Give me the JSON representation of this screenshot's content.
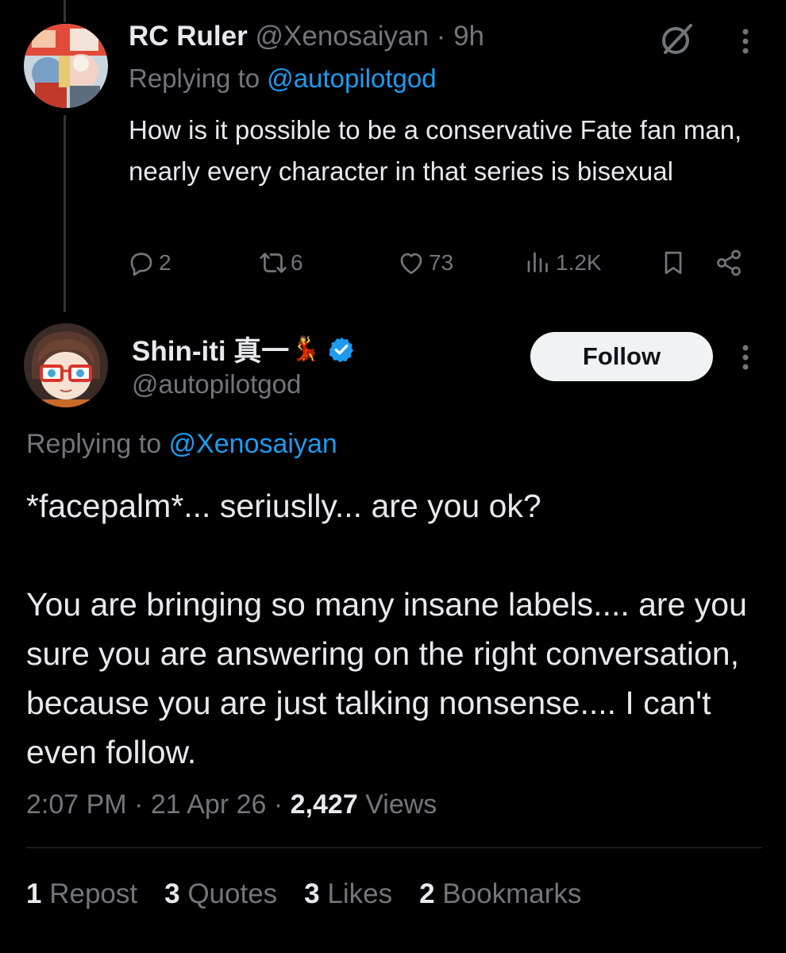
{
  "reply_tweet": {
    "display_name": "RC Ruler",
    "handle": "@Xenosaiyan",
    "separator": "·",
    "time": "9h",
    "replying_prefix": "Replying to",
    "replying_to": "@autopilotgod",
    "text": "How is it possible to be a conservative Fate fan man, nearly every character in that series is bisexual",
    "actions": {
      "reply_count": "2",
      "repost_count": "6",
      "like_count": "73",
      "views_count": "1.2K"
    }
  },
  "main_tweet": {
    "display_name": "Shin-iti 真一",
    "name_emoji": "💃",
    "handle": "@autopilotgod",
    "follow_label": "Follow",
    "replying_prefix": "Replying to",
    "replying_to": "@Xenosaiyan",
    "text": "*facepalm*... seriuslly... are you ok?\n\nYou are bringing so many insane labels.... are you sure you are answering on the right conversation, because you are just talking nonsense.... I can't even follow.",
    "time": "2:07 PM",
    "date": "21 Apr 26",
    "separator": "·",
    "views_count": "2,427",
    "views_label": "Views",
    "stats": [
      {
        "count": "1",
        "label": "Repost"
      },
      {
        "count": "3",
        "label": "Quotes"
      },
      {
        "count": "3",
        "label": "Likes"
      },
      {
        "count": "2",
        "label": "Bookmarks"
      }
    ]
  },
  "icons": {
    "reply": "reply-icon",
    "repost": "repost-icon",
    "like": "heart-icon",
    "views": "views-icon",
    "bookmark": "bookmark-icon",
    "share": "share-icon",
    "grok": "grok-icon",
    "more": "more-vertical-icon",
    "verified": "verified-badge-icon"
  },
  "colors": {
    "background": "#000000",
    "text_primary": "#e7e9ea",
    "text_secondary": "#71767b",
    "accent": "#1d9bf0",
    "follow_button_bg": "#eff3f4"
  }
}
